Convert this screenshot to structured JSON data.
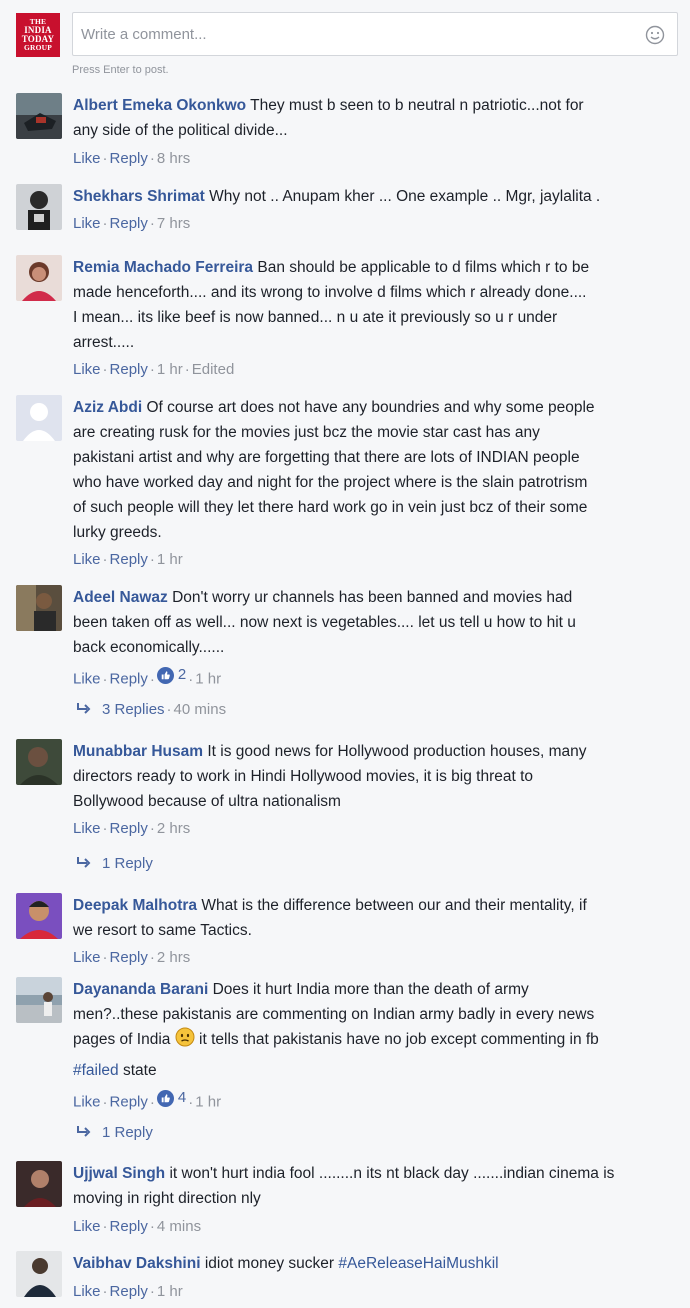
{
  "composer": {
    "logo_lines": [
      "THE",
      "INDIA",
      "TODAY",
      "GROUP"
    ],
    "placeholder": "Write a comment...",
    "hint": "Press Enter to post.",
    "emoji_icon": "smiley-icon"
  },
  "labels": {
    "like": "Like",
    "reply": "Reply",
    "sep": "·"
  },
  "colors": {
    "author": "#365899",
    "meta": "#90949c",
    "logo": "#c8102e",
    "like_badge": "#4267b2"
  },
  "comments": [
    {
      "author": "Albert Emeka Okonkwo",
      "lines": [
        "They must b seen to b neutral n patriotic...not for",
        "any side of the political divide..."
      ],
      "time": "8 hrs"
    },
    {
      "author": "Shekhars Shrimat",
      "lines": [
        "Why not .. Anupam kher ... One example .. Mgr, jaylalita ."
      ],
      "time": "7 hrs"
    },
    {
      "author": "Remia Machado Ferreira",
      "lines": [
        "Ban should be applicable to d films which r to be",
        "made henceforth.... and its wrong to involve d films which r already done....",
        "I mean... its like beef is now banned... n u ate it previously so u r under",
        "arrest....."
      ],
      "time": "1 hr",
      "edited": "Edited"
    },
    {
      "author": "Aziz Abdi",
      "lines": [
        "Of course art does not have any boundries and why some people",
        "are creating rusk for the movies just bcz the movie star cast has any",
        "pakistani artist and why are forgetting that there are lots of INDIAN people",
        "who have worked day and night for the project where is the slain patrotrism",
        "of such people will they let there hard work go in vein just bcz of their some",
        "lurky greeds."
      ],
      "time": "1 hr"
    },
    {
      "author": "Adeel Nawaz",
      "lines": [
        "Don't worry ur channels has been banned and movies had",
        "been taken off as well... now next is vegetables.... let us tell u how to hit u",
        "back economically......"
      ],
      "time": "1 hr",
      "likes": "2",
      "replies": "3 Replies",
      "replies_time": "40 mins"
    },
    {
      "author": "Munabbar Husam",
      "lines": [
        "It is good news for Hollywood production houses, many",
        "directors ready to work in Hindi Hollywood movies, it is big threat to",
        "Bollywood because of ultra nationalism"
      ],
      "time": "2 hrs",
      "replies": "1 Reply"
    },
    {
      "author": "Deepak Malhotra",
      "lines": [
        "What is the difference between our and their mentality, if",
        "we resort to same Tactics."
      ],
      "time": "2 hrs"
    },
    {
      "author": "Dayananda Barani",
      "lines": [
        "Does it hurt India more than the death of army",
        "men?..these pakistanis are commenting on Indian army badly in every news",
        "pages of India",
        "it tells that pakistanis have no job except commenting in fb",
        "#failed",
        "state"
      ],
      "time": "1 hr",
      "likes": "4",
      "replies": "1 Reply"
    },
    {
      "author": "Ujjwal Singh",
      "lines": [
        "it won't hurt india fool ........n its nt black day .......indian cinema is",
        "moving in right direction nly"
      ],
      "time": "4 mins"
    },
    {
      "author": "Vaibhav Dakshini",
      "lines": [
        "idiot money sucker",
        "#AeReleaseHaiMushkil"
      ],
      "time": "1 hr"
    }
  ]
}
